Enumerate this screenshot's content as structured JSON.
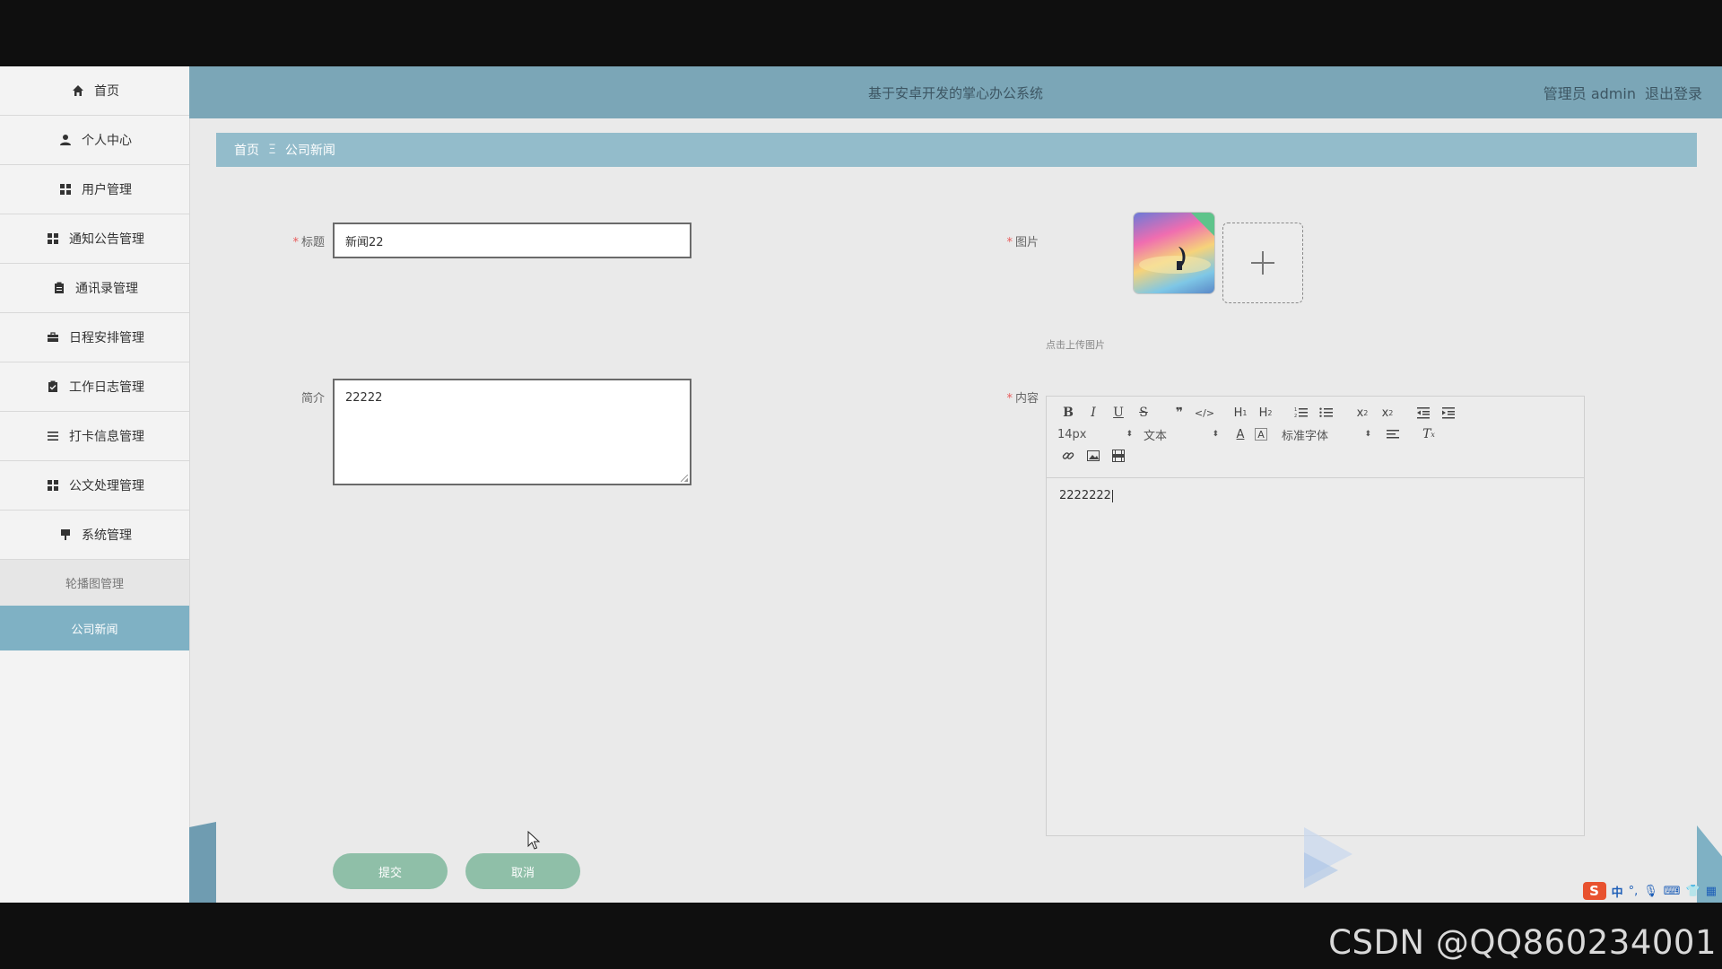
{
  "app": {
    "title": "基于安卓开发的掌心办公系统",
    "user_label": "管理员 admin",
    "logout_label": "退出登录"
  },
  "sidebar": {
    "items": [
      {
        "label": "首页",
        "icon": "home-icon"
      },
      {
        "label": "个人中心",
        "icon": "user-icon"
      },
      {
        "label": "用户管理",
        "icon": "grid-icon"
      },
      {
        "label": "通知公告管理",
        "icon": "grid-icon"
      },
      {
        "label": "通讯录管理",
        "icon": "clipboard-icon"
      },
      {
        "label": "日程安排管理",
        "icon": "briefcase-icon"
      },
      {
        "label": "工作日志管理",
        "icon": "clipboard-check-icon"
      },
      {
        "label": "打卡信息管理",
        "icon": "list-icon"
      },
      {
        "label": "公文处理管理",
        "icon": "grid-icon"
      },
      {
        "label": "系统管理",
        "icon": "sign-icon"
      }
    ],
    "sub_items": [
      {
        "label": "轮播图管理",
        "active": false
      },
      {
        "label": "公司新闻",
        "active": true
      }
    ]
  },
  "breadcrumb": {
    "home": "首页",
    "separator": "Ξ",
    "current": "公司新闻"
  },
  "form": {
    "title_label": "标题",
    "title_value": "新闻22",
    "summary_label": "简介",
    "summary_value": "22222",
    "image_label": "图片",
    "upload_hint": "点击上传图片",
    "content_label": "内容",
    "content_value": "2222222",
    "required_mark": "*"
  },
  "editor": {
    "font_size": "14px",
    "text_type": "文本",
    "font_family": "标准字体",
    "toolbar_icons": [
      "bold-icon",
      "italic-icon",
      "underline-icon",
      "strike-icon",
      "quote-icon",
      "code-icon",
      "h1-icon",
      "h2-icon",
      "ordered-list-icon",
      "bullet-list-icon",
      "subscript-icon",
      "superscript-icon",
      "outdent-icon",
      "indent-icon",
      "font-color-icon",
      "background-color-icon",
      "align-icon",
      "clear-format-icon",
      "link-icon",
      "image-icon",
      "video-icon"
    ]
  },
  "buttons": {
    "submit": "提交",
    "cancel": "取消"
  },
  "overlay": {
    "watermark": "CSDN @QQ860234001",
    "ime_label": "中"
  },
  "colors": {
    "header": "#7ba6b7",
    "breadcrumb": "#93bccb",
    "active_menu": "#7fb1c4",
    "button": "#8fbfa8"
  }
}
